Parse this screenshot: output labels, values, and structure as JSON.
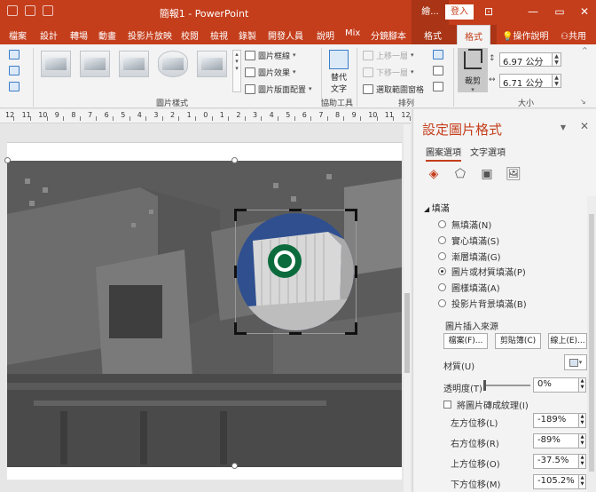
{
  "window": {
    "title": "簡報1 - PowerPoint",
    "context_label": "繪...",
    "login_label": "登入",
    "minimize": "—",
    "restore": "▭",
    "close": "✕"
  },
  "tabs": [
    "檔案",
    "設計",
    "轉場",
    "動畫",
    "投影片放映",
    "校閱",
    "檢視",
    "錄製",
    "開發人員",
    "說明",
    "Mix",
    "分鏡腳本",
    "格式",
    "格式"
  ],
  "tell_me": "操作說明",
  "share": "共用",
  "ribbon": {
    "picture_styles_label": "圖片樣式",
    "border_label": "圖片框線",
    "effects_label": "圖片效果",
    "layout_label": "圖片版面配置",
    "alt_text_label_1": "替代",
    "alt_text_label_2": "文字",
    "accessibility_label": "協助工具",
    "bring_forward": "上移一層",
    "send_backward": "下移一層",
    "selection_pane": "選取範圍窗格",
    "arrange_label": "排列",
    "crop_label": "裁剪",
    "height_value": "6.97 公分",
    "width_value": "6.71 公分",
    "size_label": "大小"
  },
  "ruler_numbers": [
    "12",
    "11",
    "10",
    "9",
    "8",
    "7",
    "6",
    "5",
    "4",
    "3",
    "2",
    "1",
    "0",
    "1",
    "2",
    "3",
    "4",
    "5",
    "6",
    "7",
    "8",
    "9",
    "10",
    "11",
    "12"
  ],
  "pane": {
    "title": "設定圖片格式",
    "tab_picture": "圖案選項",
    "tab_text": "文字選項",
    "section": "填滿",
    "fill_options": [
      {
        "label": "無填滿(N)",
        "selected": false
      },
      {
        "label": "實心填滿(S)",
        "selected": false
      },
      {
        "label": "漸層填滿(G)",
        "selected": false
      },
      {
        "label": "圖片或材質填滿(P)",
        "selected": true
      },
      {
        "label": "圖樣填滿(A)",
        "selected": false
      },
      {
        "label": "投影片背景填滿(B)",
        "selected": false
      }
    ],
    "source_label": "圖片插入來源",
    "file_button": "檔案(F)...",
    "clipboard_button": "剪貼簿(C)",
    "online_button": "線上(E)...",
    "texture_label": "材質(U)",
    "transparency_label": "透明度(T)",
    "transparency_value": "0%",
    "tile_label": "將圖片磚成紋理(I)",
    "offset_left_label": "左方位移(L)",
    "offset_left_value": "-189%",
    "offset_right_label": "右方位移(R)",
    "offset_right_value": "-89%",
    "offset_top_label": "上方位移(O)",
    "offset_top_value": "-37.5%",
    "offset_bottom_label": "下方位移(M)",
    "offset_bottom_value": "-105.2%"
  },
  "colors": {
    "accent": "#c43e1c",
    "sky": "#2f4f8f",
    "logo": "#0c6b3c"
  }
}
